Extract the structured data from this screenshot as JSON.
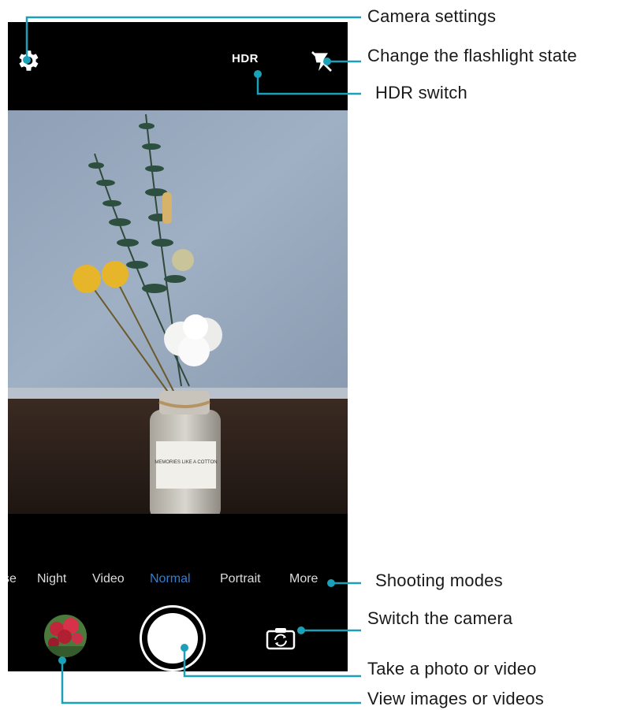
{
  "camera": {
    "hdr_label": "HDR",
    "modes": [
      {
        "label": "se",
        "active": false
      },
      {
        "label": "Night",
        "active": false
      },
      {
        "label": "Video",
        "active": false
      },
      {
        "label": "Normal",
        "active": true
      },
      {
        "label": "Portrait",
        "active": false
      },
      {
        "label": "More",
        "active": false
      }
    ],
    "accent_color": "#2f7fd6",
    "icons": [
      "gear-icon",
      "flash-off-icon",
      "gallery-thumbnail",
      "shutter-button",
      "switch-camera-icon"
    ],
    "viewfinder_label_text": "MEMORIES LIKE A COTTON"
  },
  "callouts": {
    "camera_settings": "Camera settings",
    "flashlight": "Change the flashlight state",
    "hdr_switch": "HDR switch",
    "shooting_modes": "Shooting modes",
    "switch_camera": "Switch the camera",
    "take_photo": "Take a photo or video",
    "view_images": "View images  or videos",
    "line_color": "#1aa0b8"
  }
}
